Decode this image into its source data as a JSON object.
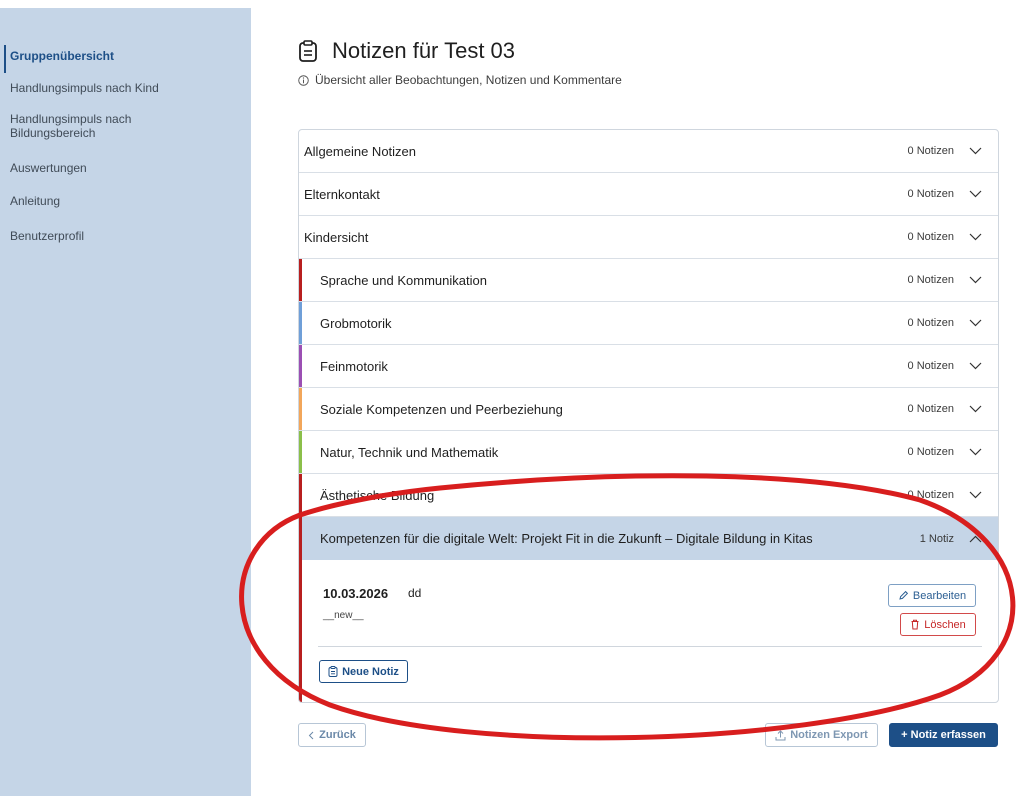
{
  "sidebar": {
    "items": [
      {
        "label": "Gruppenübersicht",
        "active": true
      },
      {
        "label": "Handlungsimpuls nach Kind"
      },
      {
        "label": "Handlungsimpuls nach Bildungsbereich"
      },
      {
        "label": "Auswertungen"
      },
      {
        "label": "Anleitung"
      },
      {
        "label": "Benutzerprofil"
      }
    ]
  },
  "header": {
    "title": "Notizen für Test 03",
    "subtitle": "Übersicht aller Beobachtungen, Notizen und Kommentare"
  },
  "accordion": {
    "rows": [
      {
        "label": "Allgemeine Notizen",
        "count": "0 Notizen"
      },
      {
        "label": "Elternkontakt",
        "count": "0 Notizen"
      },
      {
        "label": "Kindersicht",
        "count": "0 Notizen"
      },
      {
        "label": "Sprache und Kommunikation",
        "count": "0 Notizen",
        "color": "#b81f1f"
      },
      {
        "label": "Grobmotorik",
        "count": "0 Notizen",
        "color": "#6f9fd8"
      },
      {
        "label": "Feinmotorik",
        "count": "0 Notizen",
        "color": "#9b4fb3"
      },
      {
        "label": "Soziale Kompetenzen und Peerbeziehung",
        "count": "0 Notizen",
        "color": "#f2a65a"
      },
      {
        "label": "Natur, Technik und Mathematik",
        "count": "0 Notizen",
        "color": "#8bbf4a"
      },
      {
        "label": "Ästhetische Bildung",
        "count": "0 Notizen",
        "color": "#b81f1f"
      }
    ],
    "expanded": {
      "label": "Kompetenzen für die digitale Welt: Projekt Fit in die Zukunft – Digitale Bildung in Kitas",
      "count": "1 Notiz",
      "color": "#b81f1f",
      "note": {
        "date": "10.03.2026",
        "text": "dd",
        "author": "__new__",
        "edit_label": "Bearbeiten",
        "delete_label": "Löschen"
      },
      "new_note_label": "Neue Notiz"
    }
  },
  "footer": {
    "back_label": "Zurück",
    "export_label": "Notizen Export",
    "add_label": "+ Notiz erfassen"
  },
  "colors": {
    "sidebar_bg": "#c5d5e7",
    "primary": "#1d4f87",
    "danger": "#c62828",
    "annotation": "#d81e1e"
  }
}
